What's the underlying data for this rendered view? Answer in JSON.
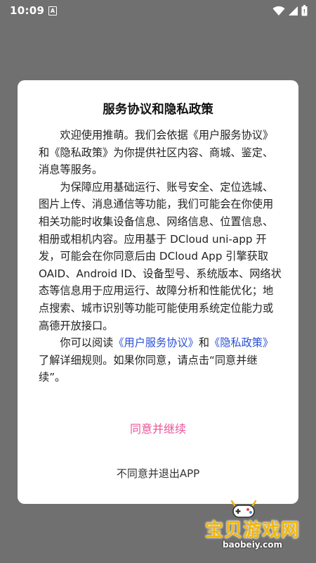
{
  "status_bar": {
    "time": "10:09",
    "notification_icon": "A",
    "icons": [
      "wifi-icon",
      "signal-icon",
      "battery-icon"
    ]
  },
  "dialog": {
    "title": "服务协议和隐私政策",
    "p1": "欢迎使用推萌。我们会依据《用户服务协议》和《隐私政策》为你提供社区内容、商城、鉴定、消息等服务。",
    "p2": "为保障应用基础运行、账号安全、定位选城、图片上传、消息通信等功能，我们可能会在你使用相关功能时收集设备信息、网络信息、位置信息、相册或相机内容。应用基于 DCloud uni-app 开发，可能会在你同意后由 DCloud App 引擎获取 OAID、Android ID、设备型号、系统版本、网络状态等信息用于应用运行、故障分析和性能优化；地点搜索、城市识别等功能可能使用系统定位能力或高德开放接口。",
    "p3_prefix": "你可以阅读",
    "link_user_agreement": "《用户服务协议》",
    "p3_and": "和",
    "link_privacy_policy": "《隐私政策》",
    "p3_suffix": "了解详细规则。如果你同意，请点击“同意并继续”。",
    "agree_label": "同意并继续",
    "exit_label": "不同意并退出APP"
  },
  "watermark": {
    "name": "宝贝游戏网",
    "url": "baobeiy.com"
  },
  "colors": {
    "overlay": "#707070",
    "link": "#2a4fd6",
    "agree": "#e8549a",
    "watermark": "#f2b705"
  }
}
